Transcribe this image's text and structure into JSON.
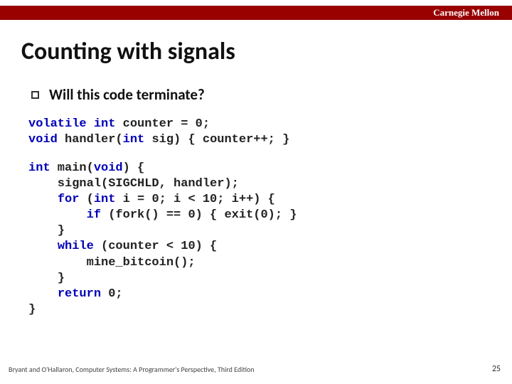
{
  "brand": "Carnegie Mellon",
  "title": "Counting with signals",
  "bullet": "Will this code terminate?",
  "code_block_1_tokens": [
    {
      "t": "volatile",
      "c": "kw"
    },
    {
      "t": " "
    },
    {
      "t": "int",
      "c": "kw"
    },
    {
      "t": " counter = 0;\n"
    },
    {
      "t": "void",
      "c": "kw"
    },
    {
      "t": " handler("
    },
    {
      "t": "int",
      "c": "kw"
    },
    {
      "t": " sig) { counter++; }"
    }
  ],
  "code_block_2_tokens": [
    {
      "t": "int",
      "c": "kw"
    },
    {
      "t": " main("
    },
    {
      "t": "void",
      "c": "kw"
    },
    {
      "t": ") {\n"
    },
    {
      "t": "    signal(SIGCHLD, handler);\n"
    },
    {
      "t": "    "
    },
    {
      "t": "for",
      "c": "kw"
    },
    {
      "t": " ("
    },
    {
      "t": "int",
      "c": "kw"
    },
    {
      "t": " i = 0; i < 10; i++) {\n"
    },
    {
      "t": "        "
    },
    {
      "t": "if",
      "c": "kw"
    },
    {
      "t": " (fork() == 0) { exit(0); }\n"
    },
    {
      "t": "    }\n"
    },
    {
      "t": "    "
    },
    {
      "t": "while",
      "c": "kw"
    },
    {
      "t": " (counter < 10) {\n"
    },
    {
      "t": "        mine_bitcoin();\n"
    },
    {
      "t": "    }\n"
    },
    {
      "t": "    "
    },
    {
      "t": "return",
      "c": "kw"
    },
    {
      "t": " 0;\n"
    },
    {
      "t": "}"
    }
  ],
  "footer": "Bryant and O'Hallaron, Computer Systems: A Programmer's Perspective, Third Edition",
  "page_number": "25"
}
